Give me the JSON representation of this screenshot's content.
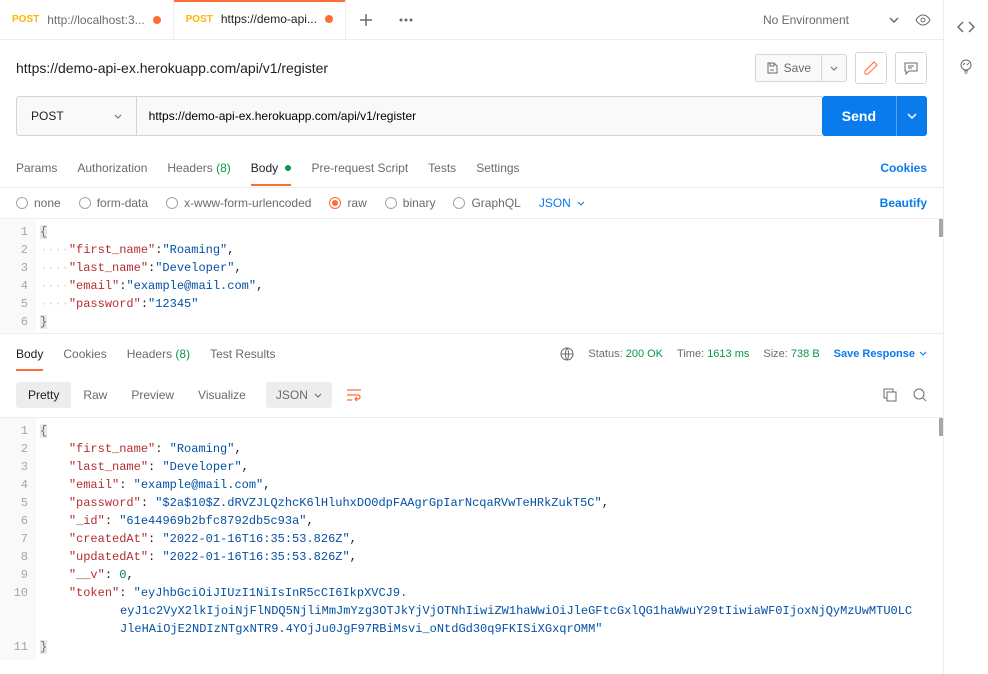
{
  "tabs": [
    {
      "method": "POST",
      "title": "http://localhost:3...",
      "dirty": true,
      "active": false
    },
    {
      "method": "POST",
      "title": "https://demo-api...",
      "dirty": true,
      "active": true
    }
  ],
  "environment": {
    "label": "No Environment"
  },
  "title": "https://demo-api-ex.herokuapp.com/api/v1/register",
  "save": {
    "label": "Save"
  },
  "request": {
    "method": "POST",
    "url": "https://demo-api-ex.herokuapp.com/api/v1/register",
    "send_label": "Send"
  },
  "request_tabs": {
    "params": "Params",
    "authorization": "Authorization",
    "headers": "Headers",
    "headers_count": "(8)",
    "body": "Body",
    "prerequest": "Pre-request Script",
    "tests": "Tests",
    "settings": "Settings",
    "cookies": "Cookies"
  },
  "body_types": {
    "none": "none",
    "formdata": "form-data",
    "urlencoded": "x-www-form-urlencoded",
    "raw": "raw",
    "binary": "binary",
    "graphql": "GraphQL",
    "lang": "JSON",
    "beautify": "Beautify"
  },
  "request_body": {
    "lines": [
      {
        "n": 1,
        "pre": "",
        "open": "{"
      },
      {
        "n": 2,
        "pre": "····",
        "key": "\"first_name\"",
        "val": "\"Roaming\"",
        "comma": ","
      },
      {
        "n": 3,
        "pre": "····",
        "key": "\"last_name\"",
        "val": "\"Developer\"",
        "comma": ","
      },
      {
        "n": 4,
        "pre": "····",
        "key": "\"email\"",
        "val": "\"example@mail.com\"",
        "comma": ","
      },
      {
        "n": 5,
        "pre": "····",
        "key": "\"password\"",
        "val": "\"12345\"",
        "comma": ""
      },
      {
        "n": 6,
        "pre": "",
        "close": "}"
      }
    ]
  },
  "response_tabs": {
    "body": "Body",
    "cookies": "Cookies",
    "headers": "Headers",
    "headers_count": "(8)",
    "test_results": "Test Results"
  },
  "response_meta": {
    "status_label": "Status:",
    "status_value": "200 OK",
    "time_label": "Time:",
    "time_value": "1613 ms",
    "size_label": "Size:",
    "size_value": "738 B",
    "save": "Save Response"
  },
  "response_view": {
    "pretty": "Pretty",
    "raw": "Raw",
    "preview": "Preview",
    "visualize": "Visualize",
    "lang": "JSON"
  },
  "response_body": {
    "lines": [
      {
        "n": 1,
        "pre": "",
        "open": "{"
      },
      {
        "n": 2,
        "pre": "    ",
        "key": "\"first_name\"",
        "val": "\"Roaming\"",
        "comma": ","
      },
      {
        "n": 3,
        "pre": "    ",
        "key": "\"last_name\"",
        "val": "\"Developer\"",
        "comma": ","
      },
      {
        "n": 4,
        "pre": "    ",
        "key": "\"email\"",
        "val": "\"example@mail.com\"",
        "comma": ","
      },
      {
        "n": 5,
        "pre": "    ",
        "key": "\"password\"",
        "val": "\"$2a$10$Z.dRVZJLQzhcK6lHluhxDO0dpFAAgrGpIarNcqaRVwTeHRkZukT5C\"",
        "comma": ","
      },
      {
        "n": 6,
        "pre": "    ",
        "key": "\"_id\"",
        "val": "\"61e44969b2bfc8792db5c93a\"",
        "comma": ","
      },
      {
        "n": 7,
        "pre": "    ",
        "key": "\"createdAt\"",
        "val": "\"2022-01-16T16:35:53.826Z\"",
        "comma": ","
      },
      {
        "n": 8,
        "pre": "    ",
        "key": "\"updatedAt\"",
        "val": "\"2022-01-16T16:35:53.826Z\"",
        "comma": ","
      },
      {
        "n": 9,
        "pre": "    ",
        "key": "\"__v\"",
        "num": "0",
        "comma": ","
      },
      {
        "n": 10,
        "pre": "    ",
        "key": "\"token\"",
        "val": "\"eyJhbGciOiJIUzI1NiIsInR5cCI6IkpXVCJ9.",
        "comma": ""
      },
      {
        "wrap": true,
        "val": "eyJ1c2VyX2lkIjoiNjFlNDQ5NjliMmJmYzg3OTJkYjVjOTNhIiwiZW1haWwiOiJleGFtcGxlQG1haWwuY29tIiwiaWF0IjoxNjQyMzUwMTU0LC"
      },
      {
        "wrap": true,
        "val": "JleHAiOjE2NDIzNTgxNTR9.4YOjJu0JgF97RBiMsvi_oNtdGd30q9FKISiXGxqrOMM\""
      },
      {
        "n": 11,
        "pre": "",
        "close": "}"
      }
    ]
  }
}
